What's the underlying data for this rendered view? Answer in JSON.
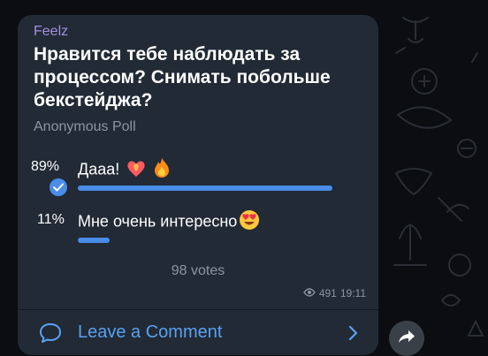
{
  "post": {
    "sender": "Feelz",
    "question": "Нравится тебе наблюдать за процессом? Снимать побольше бекстейджа?",
    "poll_type": "Anonymous Poll",
    "options": [
      {
        "percent": "89%",
        "label": "Дааа!",
        "fill": 0.89,
        "selected": true,
        "emojis": [
          "heart-on-fire-icon",
          "fire-icon"
        ]
      },
      {
        "percent": "11%",
        "label": "Мне очень интересно",
        "fill": 0.11,
        "selected": false,
        "emojis": [
          "heart-eyes-icon"
        ]
      }
    ],
    "votes": "98 votes",
    "views": "491",
    "time": "19:11",
    "comment_label": "Leave a Comment"
  },
  "colors": {
    "card_bg": "#212a35",
    "sender": "#a58fe0",
    "accent": "#4a8ce8",
    "link": "#5aa1f0",
    "muted": "#8d95a1"
  }
}
